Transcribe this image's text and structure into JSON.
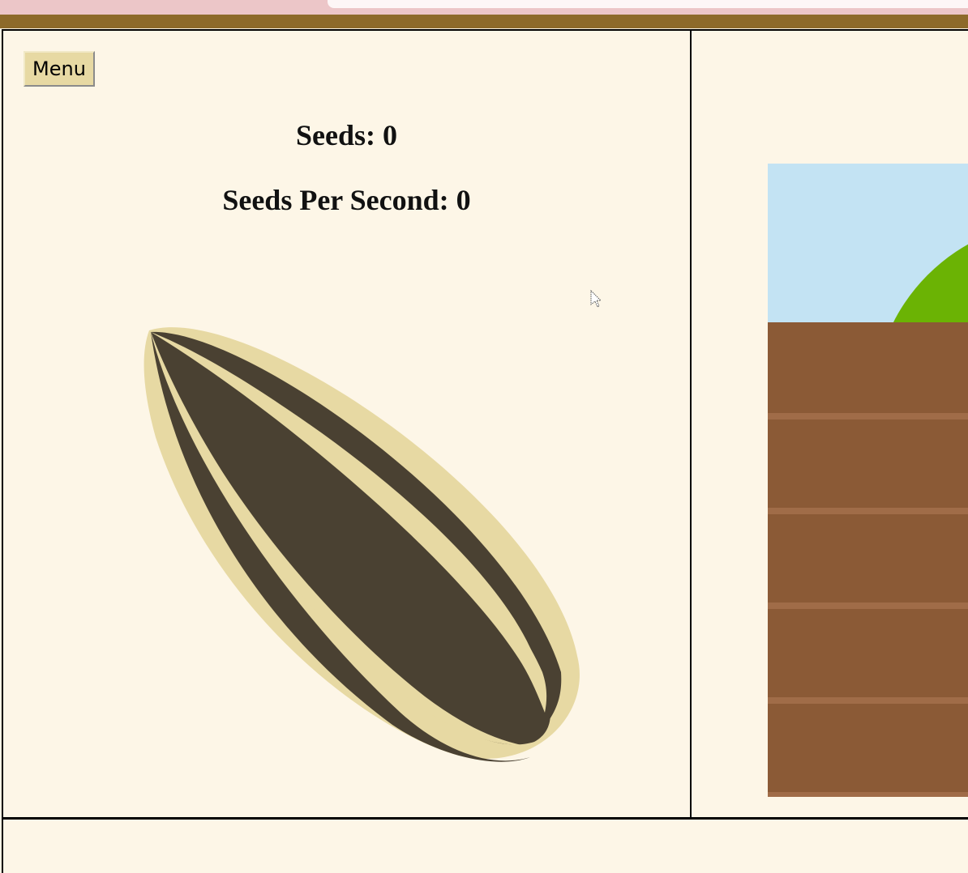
{
  "menu": {
    "label": "Menu"
  },
  "stats": {
    "seeds_label": "Seeds: 0",
    "seeds_per_second_label": "Seeds Per Second: 0"
  },
  "colors": {
    "background": "#fdf6e7",
    "header_bar": "#8d6a2a",
    "seed_shell": "#e7d9a3",
    "seed_stripe": "#4a4132",
    "sky": "#c3e3f3",
    "sun_green": "#6bb304",
    "soil": "#8b5a36",
    "soil_line": "#a06c48"
  },
  "icons": {
    "seed": "sunflower-seed-icon",
    "cursor": "mouse-cursor-icon"
  }
}
